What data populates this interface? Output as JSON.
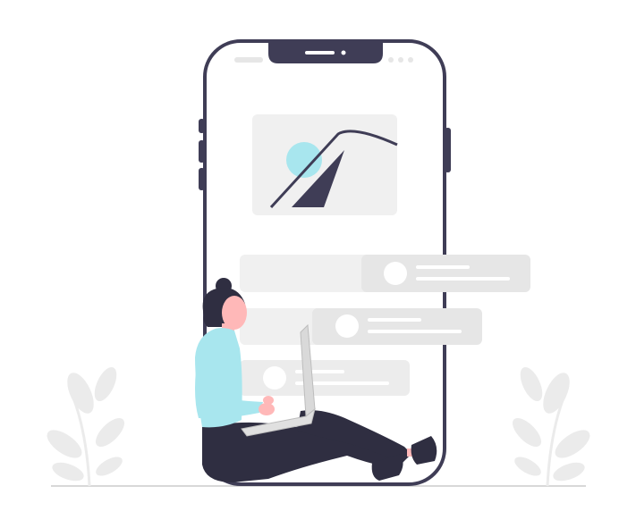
{
  "illustration": {
    "subject": "person-sitting-with-laptop-leaning-on-phone",
    "colors": {
      "background": "#ffffff",
      "phone_outline": "#3f3d56",
      "screen": "#ffffff",
      "placeholder": "#e9e9e9",
      "card": "#e6e6e6",
      "card_light": "#f0f0f0",
      "card_dot": "#ffffff",
      "accent": "#a8e6ee",
      "skin": "#ffb8b8",
      "hair": "#2f2e41",
      "pants": "#2f2e41",
      "shirt": "#a8e6ee",
      "laptop": "#e0e0e0",
      "plant": "#ebebeb",
      "ground": "#d8d8d8"
    },
    "icons": {
      "status_left": "status-pill-icon",
      "status_right": "status-dots-icon",
      "image_placeholder": "image-placeholder-icon"
    }
  }
}
